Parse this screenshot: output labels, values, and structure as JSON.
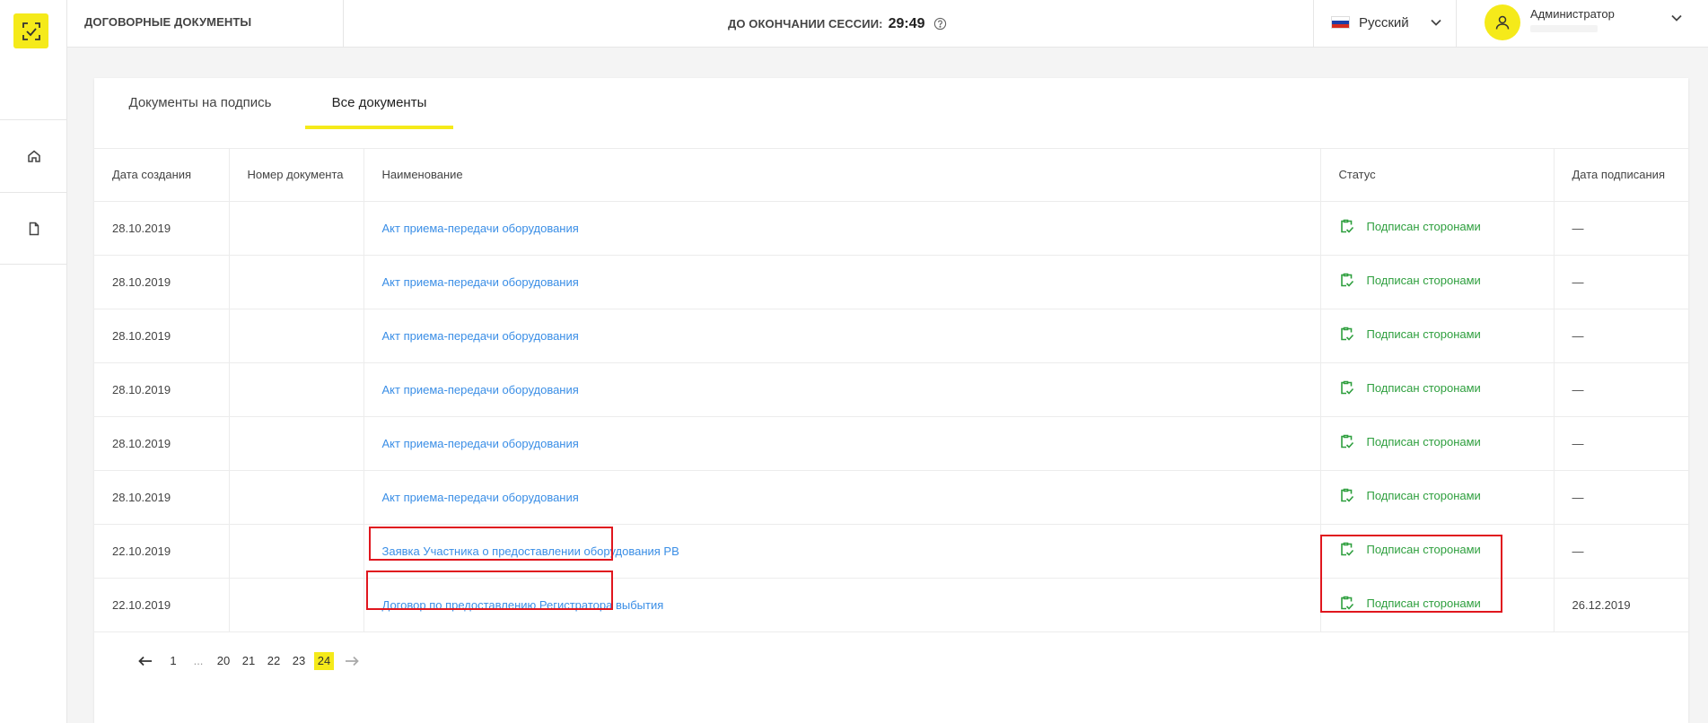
{
  "header": {
    "app_title": "ДОГОВОРНЫЕ ДОКУМЕНТЫ",
    "session_label": "ДО ОКОНЧАНИИ СЕССИИ:",
    "session_time": "29:49",
    "language": "Русский",
    "user_name": "Администратор"
  },
  "tabs": [
    {
      "label": "Документы на подпись",
      "active": false
    },
    {
      "label": "Все документы",
      "active": true
    }
  ],
  "table": {
    "columns": [
      "Дата создания",
      "Номер документа",
      "Наименование",
      "Статус",
      "Дата подписания"
    ],
    "rows": [
      {
        "created": "28.10.2019",
        "number": "",
        "name": "Акт приема-передачи оборудования",
        "status": "Подписан сторонами",
        "signed": "—"
      },
      {
        "created": "28.10.2019",
        "number": "",
        "name": "Акт приема-передачи оборудования",
        "status": "Подписан сторонами",
        "signed": "—"
      },
      {
        "created": "28.10.2019",
        "number": "",
        "name": "Акт приема-передачи оборудования",
        "status": "Подписан сторонами",
        "signed": "—"
      },
      {
        "created": "28.10.2019",
        "number": "",
        "name": "Акт приема-передачи оборудования",
        "status": "Подписан сторонами",
        "signed": "—"
      },
      {
        "created": "28.10.2019",
        "number": "",
        "name": "Акт приема-передачи оборудования",
        "status": "Подписан сторонами",
        "signed": "—"
      },
      {
        "created": "28.10.2019",
        "number": "",
        "name": "Акт приема-передачи оборудования",
        "status": "Подписан сторонами",
        "signed": "—"
      },
      {
        "created": "22.10.2019",
        "number": "",
        "name": "Заявка Участника о предоставлении оборудования РВ",
        "status": "Подписан сторонами",
        "signed": "—"
      },
      {
        "created": "22.10.2019",
        "number": "",
        "name": "Договор по предоставлению Регистратора выбытия",
        "status": "Подписан сторонами",
        "signed": "26.12.2019"
      }
    ]
  },
  "pagination": {
    "pages": [
      "1",
      "...",
      "20",
      "21",
      "22",
      "23",
      "24"
    ],
    "current": "24"
  },
  "colors": {
    "accent": "#f5ea1a",
    "link": "#3a8ee6",
    "status_ok": "#2e9f3e",
    "highlight": "#e0161e"
  },
  "icons": {
    "logo": "scan-frame-icon",
    "nav": [
      "home-icon",
      "document-icon"
    ],
    "status": "signed-document-icon"
  }
}
